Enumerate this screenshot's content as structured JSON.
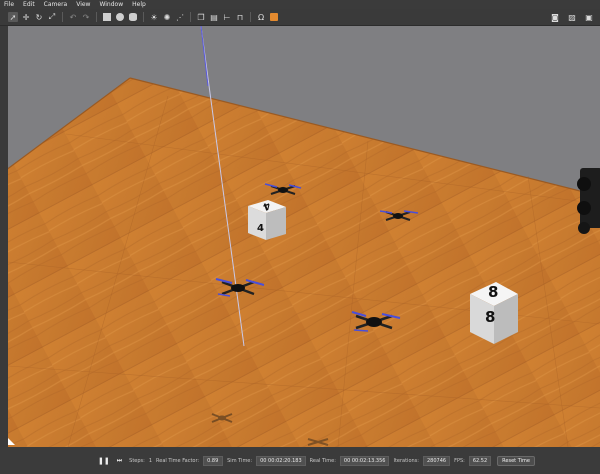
{
  "menu": [
    "File",
    "Edit",
    "Camera",
    "View",
    "Window",
    "Help"
  ],
  "toolbar": {
    "tools": [
      "select-arrow-icon",
      "translate-icon",
      "rotate-icon",
      "scale-icon",
      "undo-icon",
      "redo-icon",
      "box-icon",
      "sphere-icon",
      "cylinder-icon",
      "sun-light-icon",
      "point-light-icon",
      "spot-light-icon",
      "copy-icon",
      "paste-icon",
      "align-icon",
      "snap-icon",
      "headphones-icon",
      "record-icon"
    ],
    "right": [
      "camera-icon",
      "chart-icon",
      "video-icon"
    ]
  },
  "scene": {
    "cubes": [
      {
        "top": "4",
        "front": "4"
      },
      {
        "top": "8",
        "front": "8"
      }
    ]
  },
  "status": {
    "steps_label": "Steps:",
    "steps_value": "1",
    "rtf_label": "Real Time Factor:",
    "rtf_value": "0.89",
    "sim_time_label": "Sim Time:",
    "sim_time_value": "00 00:02:20.183",
    "real_time_label": "Real Time:",
    "real_time_value": "00 00:02:13.356",
    "iterations_label": "Iterations:",
    "iterations_value": "280746",
    "fps_label": "FPS:",
    "fps_value": "62.52",
    "reset_label": "Reset Time"
  }
}
